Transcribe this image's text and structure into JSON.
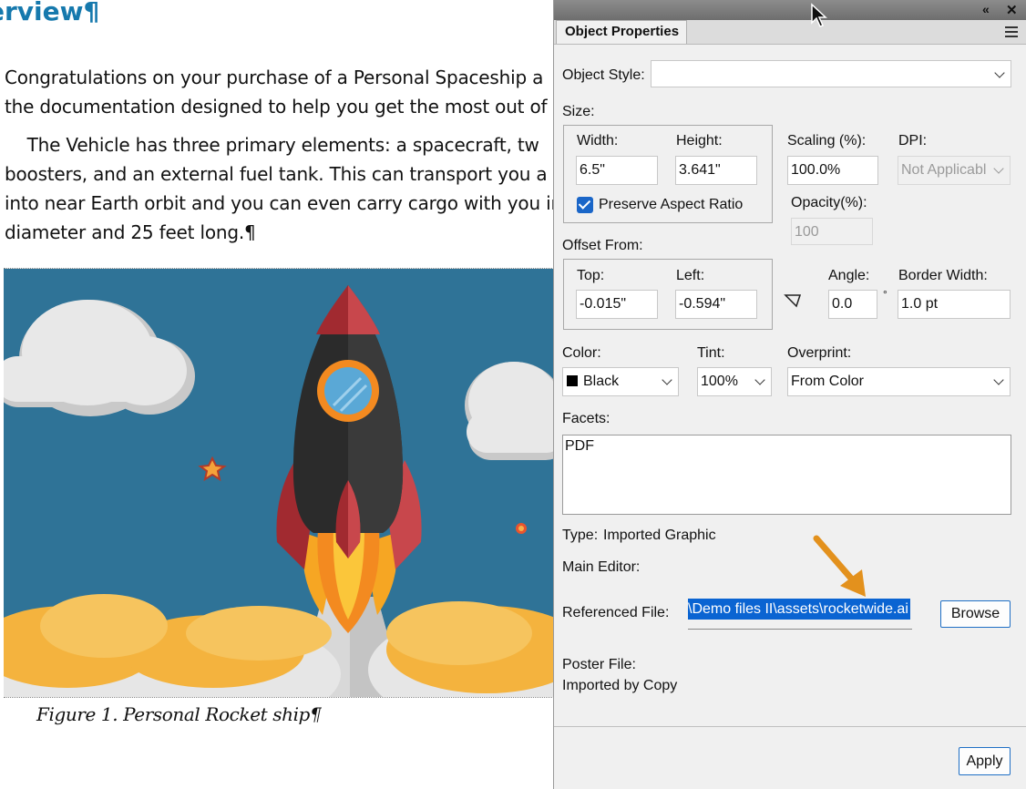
{
  "document": {
    "heading": "erview¶",
    "paragraph1": [
      "Congratulations on your purchase of a Personal Spaceship a",
      "the documentation designed to help you get the most out of"
    ],
    "paragraph2": [
      "    The Vehicle has three primary elements: a spacecraft, tw",
      "boosters, and an external fuel tank. This can transport you a",
      "into near Earth orbit and you can even carry cargo with you in",
      "diameter and 25 feet long.¶"
    ],
    "caption": "Figure 1. Personal Rocket ship¶",
    "figure_icon": "rocket-illustration"
  },
  "panel": {
    "tab": "Object Properties",
    "object_style": {
      "label": "Object Style:",
      "value": ""
    },
    "size": {
      "label": "Size:",
      "width_label": "Width:",
      "width": "6.5\"",
      "height_label": "Height:",
      "height": "3.641\"",
      "scaling_label": "Scaling (%):",
      "scaling": "100.0%",
      "dpi_label": "DPI:",
      "dpi": "Not Applicabl",
      "opacity_label": "Opacity(%):",
      "opacity": "100",
      "preserve_label": "Preserve Aspect Ratio",
      "preserve_checked": true
    },
    "offset": {
      "label": "Offset From:",
      "top_label": "Top:",
      "top": "-0.015\"",
      "left_label": "Left:",
      "left": "-0.594\"",
      "angle_label": "Angle:",
      "angle": "0.0",
      "degree": "°",
      "border_label": "Border Width:",
      "border": "1.0 pt"
    },
    "color": {
      "label": "Color:",
      "value": "Black",
      "swatch": "#000000"
    },
    "tint": {
      "label": "Tint:",
      "value": "100%"
    },
    "overprint": {
      "label": "Overprint:",
      "value": "From Color"
    },
    "facets": {
      "label": "Facets:",
      "value": "PDF"
    },
    "type_label": "Type:",
    "type_value": "Imported Graphic",
    "main_editor": "Main Editor:",
    "referenced_label": "Referenced File:",
    "referenced_value": "\\Demo files II\\assets\\rocketwide.ai",
    "browse": "Browse",
    "poster_file": "Poster File:",
    "imported_by": "Imported by Copy",
    "apply": "Apply",
    "accent": "#1f6fc5",
    "selection_color": "#0a64d2"
  }
}
